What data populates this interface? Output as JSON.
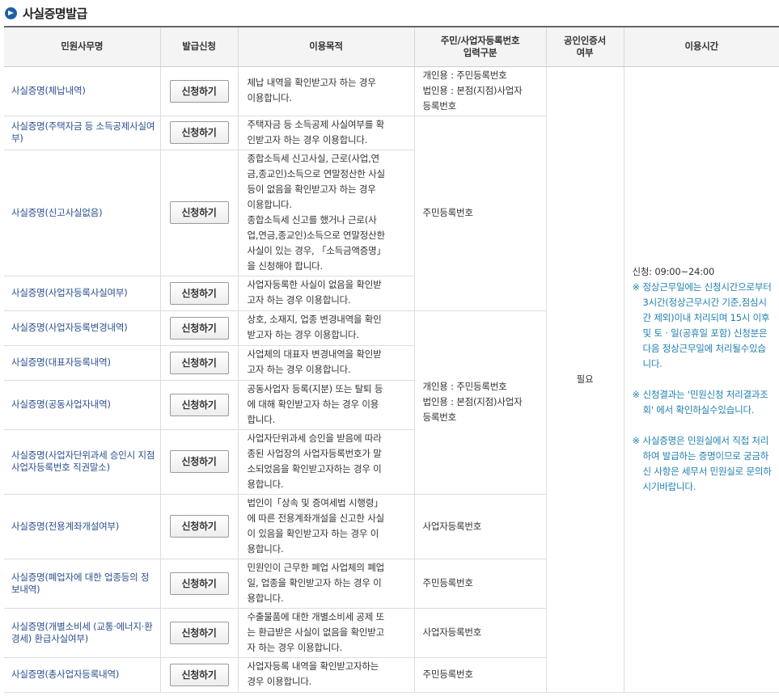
{
  "page": {
    "title": "사실증명발급"
  },
  "table": {
    "headers": {
      "name": "민원사무명",
      "apply": "발급신청",
      "purpose": "이용목적",
      "idtype": "주민/사업자등록번호\n입력구분",
      "cert": "공인인증서\n여부",
      "time": "이용시간"
    },
    "apply_label": "신청하기",
    "rows": [
      {
        "name": "사실증명(체납내역)",
        "purpose": "체납 내역을 확인받고자 하는 경우\n이용합니다."
      },
      {
        "name": "사실증명(주택자금 등 소득공제사실여부)",
        "purpose": "주택자금 등 소득공제 사실여부를 확\n인받고자 하는 경우 이용합니다."
      },
      {
        "name": "사실증명(신고사실없음)",
        "purpose": "종합소득세 신고사실, 근로(사업,연\n금,종교인)소득으로 연말정산한 사실\n등이 없음을 확인받고자 하는 경우\n이용합니다.\n종합소득세 신고를 했거나 근로(사\n업,연금,종교인)소득으로 연말정산한\n사실이 있는 경우, 「소득금액증명」\n을 신청해야 합니다."
      },
      {
        "name": "사실증명(사업자등록사실여부)",
        "purpose": "사업자등록한 사실이 없음을 확인받\n고자 하는 경우 이용합니다."
      },
      {
        "name": "사실증명(사업자등록변경내역)",
        "purpose": "상호, 소재지, 업종 변경내역을 확인\n받고자 하는 경우 이용합니다."
      },
      {
        "name": "사실증명(대표자등록내역)",
        "purpose": "사업체의 대표자 변경내역을 확인받\n고자 하는 경우 이용합니다."
      },
      {
        "name": "사실증명(공동사업자내역)",
        "purpose": "공동사업자 등록(지분) 또는 탈퇴 등\n에 대해 확인받고자 하는 경우 이용\n합니다."
      },
      {
        "name": "사실증명(사업자단위과세 승인시 지점사업자등록번호 직권말소)",
        "purpose": "사업자단위과세 승인을 받음에 따라\n종된 사업장의 사업자등록번호가 말\n소되었음을 확인받고자하는 경우 이\n용합니다."
      },
      {
        "name": "사실증명(전용계좌개설여부)",
        "purpose": "법인이「상속 및 증여세법 시행령」\n에 따른 전용계좌개설을 신고한 사실\n이 있음을 확인받고자 하는 경우 이\n용합니다."
      },
      {
        "name": "사실증명(폐업자에 대한 업종등의 정보내역)",
        "purpose": "민원인이 근무한 폐업 사업체의 폐업\n일, 업종을 확인받고자 하는 경우 이\n용합니다."
      },
      {
        "name": "사실증명(개별소비세 (교통·에너지·환경세) 환급사실여부)",
        "purpose": "수출물품에 대한 개별소비세 공제 또\n는 환급받은 사실이 없음을 확인받고\n자 하는 경우 이용합니다."
      },
      {
        "name": "사실증명(총사업자등록내역)",
        "purpose": "사업자등록 내역을 확인받고자하는\n경우 이용합니다."
      }
    ],
    "idtypes": {
      "both_first": "개인용 : 주민등록번호\n법인용 : 본점(지점)사업자\n등록번호",
      "resident_group": "주민등록번호",
      "both_group": "개인용 : 주민등록번호\n법인용 : 본점(지점)사업자\n등록번호",
      "business_1": "사업자등록번호",
      "resident_1": "주민등록번호",
      "business_2": "사업자등록번호",
      "resident_2": "주민등록번호"
    },
    "cert_required": "필요",
    "usage_time": {
      "hours": "신청: 09:00~24:00",
      "notes": [
        "정상근무일에는 신청시간으로부터 3시간(정상근무시간 기준,점심시간 제외)이내 처리되며 15시 이후 및 토 · 일(공휴일 포함) 신청분은 다음 정상근무일에 처리될수있습니다.",
        "신청결과는 '민원신청 처리결과조회' 에서 확인하실수있습니다.",
        "사실증명은 민원실에서 직접 처리하여 발급하는 증명이므로 궁금하신 사항은 세무서 민원실로 문의하시기바랍니다."
      ],
      "note_mark": "※"
    }
  }
}
